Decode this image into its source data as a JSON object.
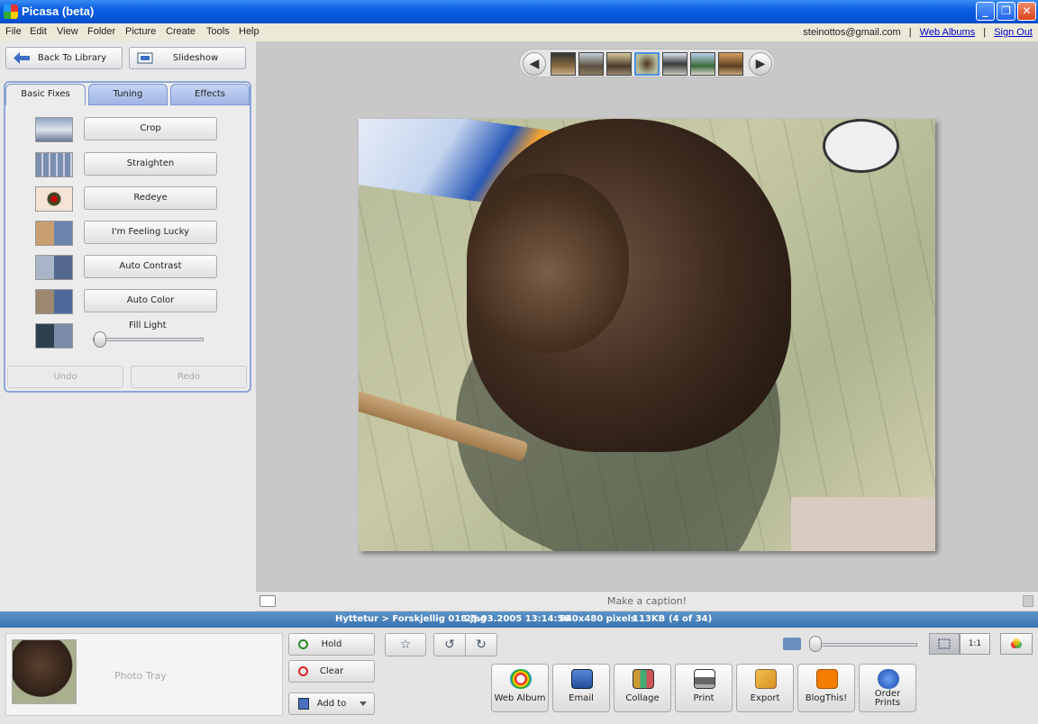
{
  "window": {
    "title": "Picasa (beta)",
    "minimize": "_",
    "restore": "❐",
    "close": "✕"
  },
  "menu": [
    "File",
    "Edit",
    "View",
    "Folder",
    "Picture",
    "Create",
    "Tools",
    "Help"
  ],
  "account": {
    "email": "steinottos@gmail.com",
    "sep": "|",
    "web_albums": "Web Albums",
    "sign_out": "Sign Out"
  },
  "left": {
    "back": "Back To Library",
    "slideshow": "Slideshow",
    "tabs": [
      "Basic Fixes",
      "Tuning",
      "Effects"
    ],
    "fixes": [
      "Crop",
      "Straighten",
      "Redeye",
      "I'm Feeling Lucky",
      "Auto Contrast",
      "Auto Color"
    ],
    "fill_light": "Fill Light",
    "fill_light_level": 0,
    "undo": "Undo",
    "redo": "Redo"
  },
  "viewer": {
    "prev": "◀",
    "next": "▶",
    "selected_index": 3,
    "caption_placeholder": "Make a caption!"
  },
  "status": {
    "path": "Hyttetur > Forskjellig 018.jpg",
    "date": "25.03.2005 13:14:56",
    "dims": "640x480 pixels",
    "size": "113KB",
    "position": "(4 of 34)"
  },
  "tray": {
    "label": "Photo Tray",
    "hold": "Hold",
    "clear": "Clear",
    "add_to": "Add to"
  },
  "toolbar": {
    "star": "☆",
    "rotate_left": "↺",
    "rotate_right": "↻",
    "one_to_one": "1:1",
    "zoom_level": 0
  },
  "actions": [
    "Web Album",
    "Email",
    "Collage",
    "Print",
    "Export",
    "BlogThis!",
    "Order Prints"
  ],
  "colors": {
    "accent": "#0552d6",
    "status": "#3a73b0"
  }
}
